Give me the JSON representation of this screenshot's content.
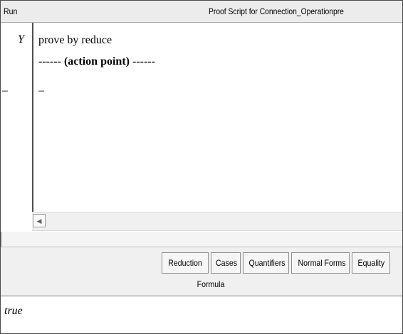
{
  "header": {
    "run_label": "Run",
    "title": "Proof Script for Connection_Operationpre"
  },
  "gutter": {
    "marker_y": "Y",
    "marker_dash": "–"
  },
  "script": {
    "line1": "prove by reduce",
    "line2_prefix": "------ ",
    "line2_bold": "(action point)",
    "line2_suffix": " ------",
    "line3": "–"
  },
  "scrollbar": {
    "left_arrow": "◀"
  },
  "toolbar": {
    "tabs": [
      "Reduction",
      "Cases",
      "Quantifiers",
      "Normal Forms",
      "Equality"
    ],
    "formula_label": "Formula"
  },
  "result": {
    "value": "true"
  }
}
